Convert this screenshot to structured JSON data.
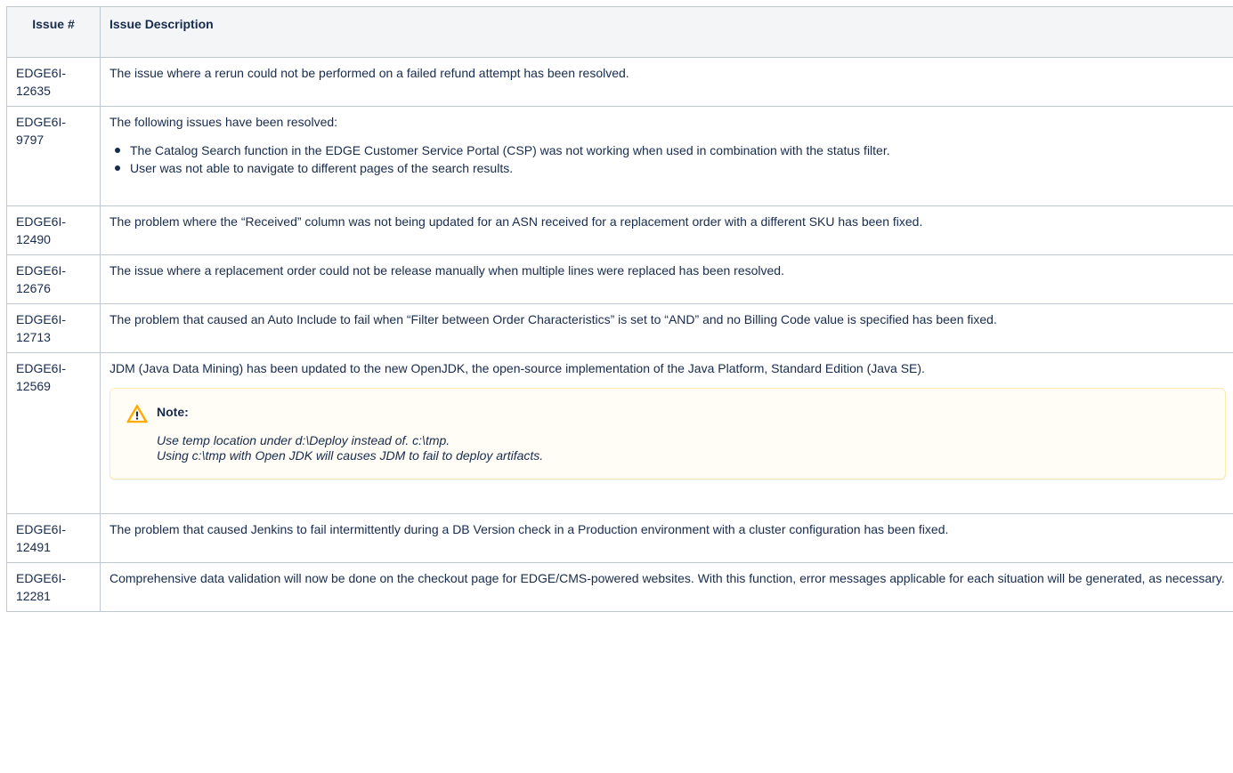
{
  "table": {
    "headers": {
      "issue_number": "Issue #",
      "issue_description": "Issue Description"
    },
    "rows": [
      {
        "id_line1": "EDGE6I-",
        "id_line2": "12635",
        "text": "The issue where a rerun could not be performed on a failed refund attempt has been resolved."
      },
      {
        "id_line1": "EDGE6I-",
        "id_line2": "9797",
        "text": "The following issues have been resolved:",
        "bullets": [
          "The Catalog Search function in the EDGE Customer Service Portal (CSP) was not working when used in combination with the status filter.",
          "User was not able to navigate to different pages of the search results."
        ]
      },
      {
        "id_line1": "EDGE6I-",
        "id_line2": "12490",
        "text": "The problem where the “Received” column was not being updated for an ASN received for a replacement order with a different SKU has been fixed."
      },
      {
        "id_line1": "EDGE6I-",
        "id_line2": "12676",
        "text": "The issue where a replacement order could not be release manually when multiple lines were replaced has been resolved."
      },
      {
        "id_line1": "EDGE6I-",
        "id_line2": "12713",
        "text": "The problem that caused an Auto Include to fail when “Filter between Order Characteristics” is set to “AND” and no Billing Code value is specified has been fixed."
      },
      {
        "id_line1": "EDGE6I-",
        "id_line2": "12569",
        "text": "JDM (Java Data Mining) has been updated to the new OpenJDK, the open-source implementation of the Java Platform, Standard Edition (Java SE).",
        "note": {
          "title": "Note:",
          "line1": "Use temp location under d:\\Deploy instead of. c:\\tmp.",
          "line2": "Using c:\\tmp with Open JDK will causes JDM to fail to deploy artifacts."
        }
      },
      {
        "id_line1": "EDGE6I-",
        "id_line2": "12491",
        "text": "The problem that caused Jenkins to fail intermittently during a DB Version check in a Production environment with a cluster configuration has been fixed."
      },
      {
        "id_line1": "EDGE6I-",
        "id_line2": "12281",
        "text": "Comprehensive data validation will now be done on the checkout page for EDGE/CMS-powered websites. With this function, error messages applicable for each situation will be generated, as necessary."
      }
    ]
  },
  "colors": {
    "border": "#c1c7d0",
    "header_bg": "#f4f5f7",
    "note_bg": "#fffdf6",
    "note_border": "#ffeaae",
    "warning_icon": "#ffab00"
  }
}
